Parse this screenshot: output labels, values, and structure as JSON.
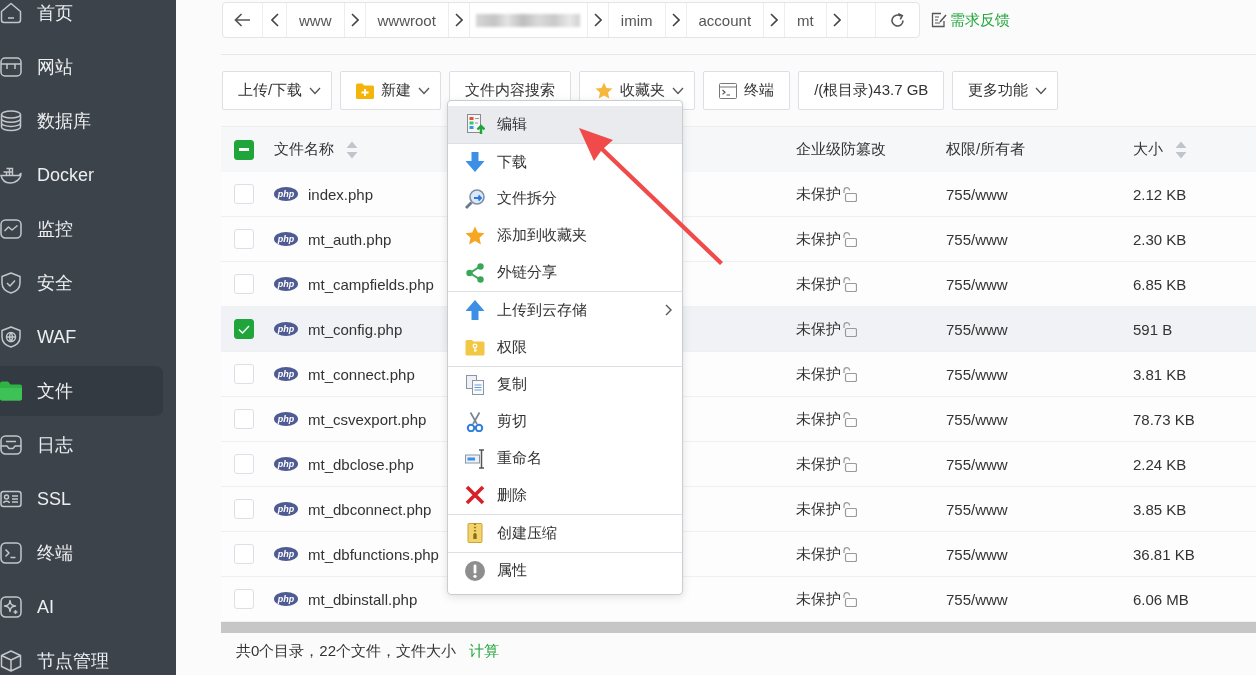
{
  "sidebar": {
    "items": [
      {
        "label": "首页",
        "selected": false
      },
      {
        "label": "网站",
        "selected": false
      },
      {
        "label": "数据库",
        "selected": false
      },
      {
        "label": "Docker",
        "selected": false
      },
      {
        "label": "监控",
        "selected": false
      },
      {
        "label": "安全",
        "selected": false
      },
      {
        "label": "WAF",
        "selected": false
      },
      {
        "label": "文件",
        "selected": true
      },
      {
        "label": "日志",
        "selected": false
      },
      {
        "label": "SSL",
        "selected": false
      },
      {
        "label": "终端",
        "selected": false
      },
      {
        "label": "AI",
        "selected": false
      },
      {
        "label": "节点管理",
        "selected": false
      }
    ]
  },
  "path_bar": {
    "segments": [
      {
        "kind": "text",
        "label": "www"
      },
      {
        "kind": "text",
        "label": "wwwroot"
      },
      {
        "kind": "redacted"
      },
      {
        "kind": "text",
        "label": "imim"
      },
      {
        "kind": "text",
        "label": "account"
      },
      {
        "kind": "text",
        "label": "mt"
      }
    ],
    "feedback_link": "需求反馈"
  },
  "toolbar": {
    "buttons": [
      {
        "label": "上传/下载",
        "dropdown": true
      },
      {
        "label": "新建",
        "dropdown": true
      },
      {
        "label": "文件内容搜索",
        "dropdown": false
      },
      {
        "label": "收藏夹",
        "dropdown": true
      },
      {
        "label": "终端",
        "dropdown": false
      },
      {
        "label": "/(根目录)43.7 GB",
        "dropdown": false
      },
      {
        "label": "更多功能",
        "dropdown": true
      }
    ]
  },
  "table": {
    "header_checkbox": {
      "indeterminate": true
    },
    "columns": [
      {
        "label": "文件名称",
        "sortable": true
      },
      {
        "label": "企业级防篡改",
        "sortable": false
      },
      {
        "label": "权限/所有者",
        "sortable": false
      },
      {
        "label": "大小",
        "sortable": true
      }
    ],
    "rows": [
      {
        "type": "php",
        "name": "index.php",
        "protection": "未保护",
        "locked": false,
        "permission": "755/www",
        "size": "2.12 KB",
        "selected": false
      },
      {
        "type": "php",
        "name": "mt_auth.php",
        "protection": "未保护",
        "locked": false,
        "permission": "755/www",
        "size": "2.30 KB",
        "selected": false
      },
      {
        "type": "php",
        "name": "mt_campfields.php",
        "protection": "未保护",
        "locked": false,
        "permission": "755/www",
        "size": "6.85 KB",
        "selected": false
      },
      {
        "type": "php",
        "name": "mt_config.php",
        "protection": "未保护",
        "locked": false,
        "permission": "755/www",
        "size": "591 B",
        "selected": true
      },
      {
        "type": "php",
        "name": "mt_connect.php",
        "protection": "未保护",
        "locked": false,
        "permission": "755/www",
        "size": "3.81 KB",
        "selected": false
      },
      {
        "type": "php",
        "name": "mt_csvexport.php",
        "protection": "未保护",
        "locked": false,
        "permission": "755/www",
        "size": "78.73 KB",
        "selected": false
      },
      {
        "type": "php",
        "name": "mt_dbclose.php",
        "protection": "未保护",
        "locked": false,
        "permission": "755/www",
        "size": "2.24 KB",
        "selected": false
      },
      {
        "type": "php",
        "name": "mt_dbconnect.php",
        "protection": "未保护",
        "locked": false,
        "permission": "755/www",
        "size": "3.85 KB",
        "selected": false
      },
      {
        "type": "php",
        "name": "mt_dbfunctions.php",
        "protection": "未保护",
        "locked": false,
        "permission": "755/www",
        "size": "36.81 KB",
        "selected": false
      },
      {
        "type": "php",
        "name": "mt_dbinstall.php",
        "protection": "未保护",
        "locked": false,
        "permission": "755/www",
        "size": "6.06 MB",
        "selected": false
      }
    ]
  },
  "context_menu": {
    "groups": [
      {
        "items": [
          {
            "label": "编辑",
            "highlighted": true,
            "submenu": false
          }
        ]
      },
      {
        "items": [
          {
            "label": "下载",
            "highlighted": false,
            "submenu": false
          },
          {
            "label": "文件拆分",
            "highlighted": false,
            "submenu": false
          },
          {
            "label": "添加到收藏夹",
            "highlighted": false,
            "submenu": false
          },
          {
            "label": "外链分享",
            "highlighted": false,
            "submenu": false
          }
        ]
      },
      {
        "items": [
          {
            "label": "上传到云存储",
            "highlighted": false,
            "submenu": true
          },
          {
            "label": "权限",
            "highlighted": false,
            "submenu": false
          }
        ]
      },
      {
        "items": [
          {
            "label": "复制",
            "highlighted": false,
            "submenu": false
          },
          {
            "label": "剪切",
            "highlighted": false,
            "submenu": false
          },
          {
            "label": "重命名",
            "highlighted": false,
            "submenu": false
          },
          {
            "label": "删除",
            "highlighted": false,
            "submenu": false
          }
        ]
      },
      {
        "items": [
          {
            "label": "创建压缩",
            "highlighted": false,
            "submenu": false
          }
        ]
      },
      {
        "items": [
          {
            "label": "属性",
            "highlighted": false,
            "submenu": false
          }
        ]
      }
    ]
  },
  "footer": {
    "summary": "共0个目录，22个文件，文件大小",
    "link": "计算"
  }
}
